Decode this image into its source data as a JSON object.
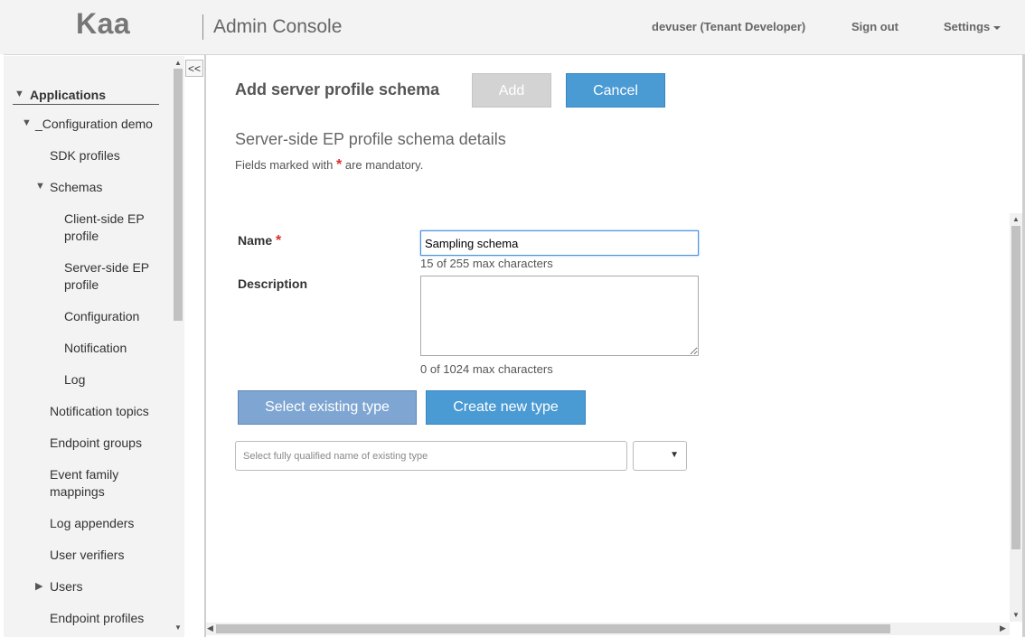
{
  "header": {
    "logo": "Kaa",
    "title": "Admin Console",
    "user": "devuser (Tenant Developer)",
    "sign_out": "Sign out",
    "settings": "Settings"
  },
  "sidebar": {
    "collapse_label": "<<",
    "applications": "Applications",
    "app_name": "_Configuration demo",
    "sdk_profiles": "SDK profiles",
    "schemas": "Schemas",
    "schema_items": {
      "client_side_1": "Client-side EP",
      "client_side_2": "profile",
      "server_side_1": "Server-side EP",
      "server_side_2": "profile",
      "configuration": "Configuration",
      "notification": "Notification",
      "log": "Log"
    },
    "notification_topics": "Notification topics",
    "endpoint_groups": "Endpoint groups",
    "event_family_1": "Event family",
    "event_family_2": "mappings",
    "log_appenders": "Log appenders",
    "user_verifiers": "User verifiers",
    "users": "Users",
    "endpoint_profiles": "Endpoint profiles"
  },
  "main": {
    "page_title": "Add server profile schema",
    "add_label": "Add",
    "cancel_label": "Cancel",
    "section_title": "Server-side EP profile schema details",
    "mandatory_prefix": "Fields marked with",
    "mandatory_star": "*",
    "mandatory_suffix": "are mandatory.",
    "name_label": "Name",
    "name_value": "Sampling schema",
    "name_counter": "15 of 255 max characters",
    "description_label": "Description",
    "description_value": "",
    "description_counter": "0 of 1024 max characters",
    "select_existing_label": "Select existing type",
    "create_new_label": "Create new type",
    "type_placeholder": "Select fully qualified name of existing type",
    "version_selected": ""
  },
  "colors": {
    "primary_button": "#4a9ad4",
    "active_toggle": "#7fa6d2",
    "disabled_button": "#d3d3d3",
    "required_star": "#d9302c"
  }
}
